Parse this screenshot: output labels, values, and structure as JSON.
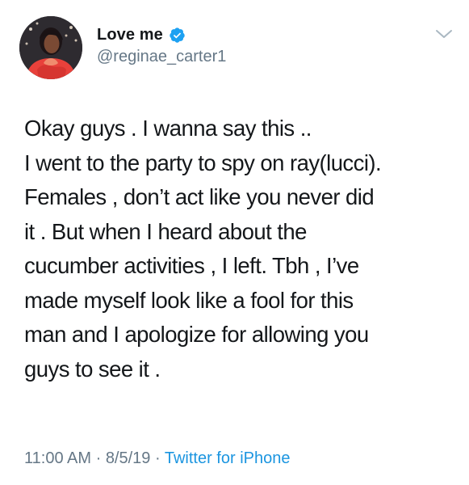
{
  "author": {
    "display_name": "Love me",
    "handle": "@reginae_carter1",
    "verified_icon": "verified-badge-icon",
    "avatar": "profile-avatar"
  },
  "menu": {
    "icon": "chevron-down-icon"
  },
  "tweet": {
    "lines": [
      "Okay guys . I wanna say this ..",
      "I went to the party to spy on ray(lucci).",
      "Females , don’t act like you never did",
      "it . But when I heard about the",
      "cucumber activities , I left. Tbh , I’ve",
      "made myself look like a fool for this",
      "man and I apologize for allowing you",
      "guys to see it ."
    ]
  },
  "meta": {
    "time": "11:00 AM",
    "sep1": " · ",
    "date": "8/5/19",
    "sep2": " · ",
    "source": "Twitter for iPhone"
  },
  "colors": {
    "text": "#14171a",
    "secondary": "#657786",
    "link": "#1b95e0",
    "verified": "#1da1f2"
  }
}
